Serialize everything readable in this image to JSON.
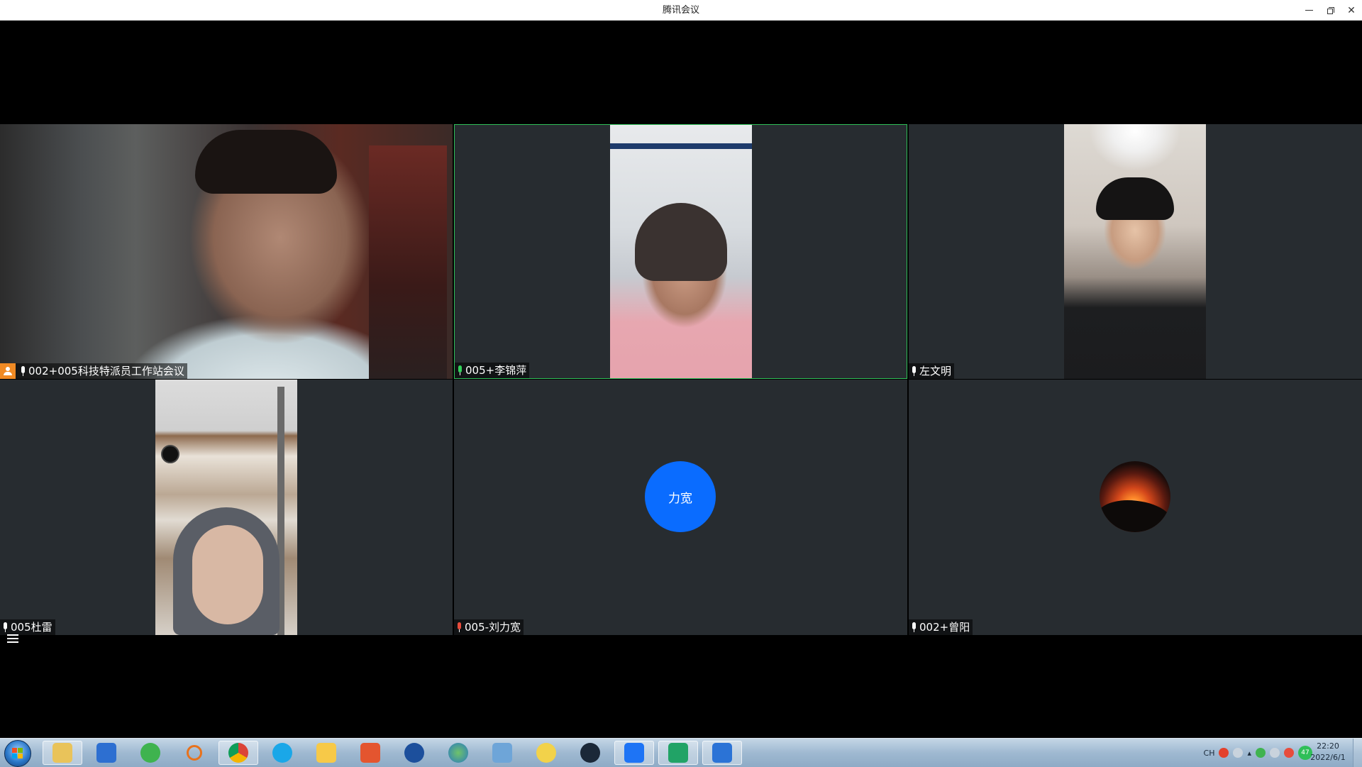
{
  "window": {
    "title": "腾讯会议"
  },
  "participants": [
    {
      "name": "002+005科技特派员工作站会议",
      "host": true,
      "mic": "on",
      "video": true
    },
    {
      "name": "005+李锦萍",
      "host": false,
      "mic": "speaking",
      "video": true,
      "active": true
    },
    {
      "name": "左文明",
      "host": false,
      "mic": "on",
      "video": true
    },
    {
      "name": "005杜雷",
      "host": false,
      "mic": "on",
      "video": true
    },
    {
      "name": "005-刘力宽",
      "host": false,
      "mic": "muted",
      "video": false,
      "avatar_text": "力宽",
      "avatar_color": "#0a6cff"
    },
    {
      "name": "002+曾阳",
      "host": false,
      "mic": "on",
      "video": false,
      "avatar_image": "sunset-photo"
    }
  ],
  "colors": {
    "active_border": "#2fbf58",
    "host_badge": "#f08a24",
    "tile_bg": "#272c30"
  },
  "taskbar": {
    "apps": [
      "file-explorer-icon",
      "ob-app-icon",
      "wechat-icon",
      "search-app-icon",
      "chrome-icon",
      "qq-browser-icon",
      "app-icon",
      "mail-app-icon",
      "media-player-icon",
      "globe-app-icon",
      "document-app-icon",
      "game-app-icon",
      "steam-icon",
      "tencent-meeting-icon",
      "wps-sheet-icon",
      "wps-writer-icon"
    ],
    "tray_lang": "CH",
    "tray_badge": "47",
    "time": "22:20",
    "date": "2022/6/1"
  }
}
